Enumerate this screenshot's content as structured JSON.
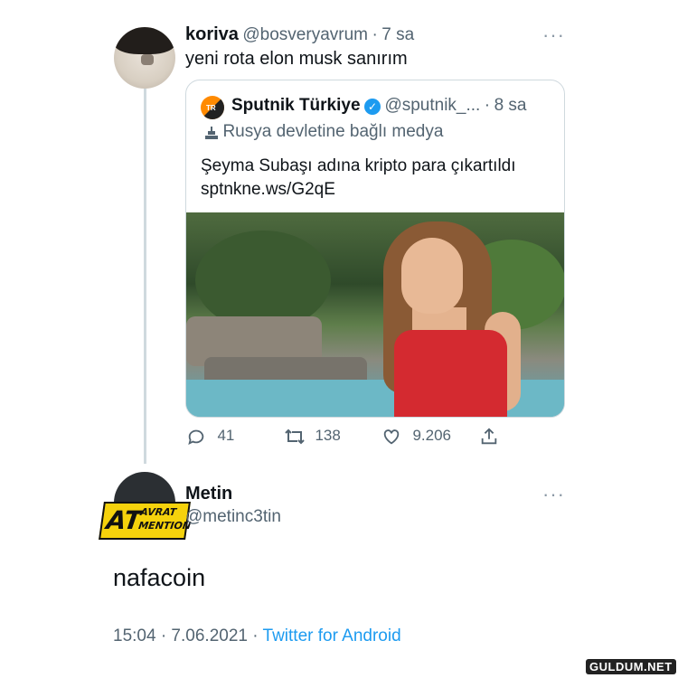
{
  "reply": {
    "display_name": "koriva",
    "handle": "@bosveryavrum",
    "separator": "·",
    "time": "7 sa",
    "text": "yeni rota elon musk sanırım",
    "more_icon": "···"
  },
  "quoted": {
    "source_name": "Sputnik Türkiye",
    "verified_icon": "✓",
    "handle": "@sputnik_...",
    "separator": "·",
    "time": "8 sa",
    "label_icon": "state-media-icon",
    "label": "Rusya devletine bağlı medya",
    "text_line1": "Şeyma Subaşı adına kripto para çıkartıldı",
    "text_line2": "sptnkne.ws/G2qE",
    "logo_text": "TR"
  },
  "actions": {
    "replies": "41",
    "retweets": "138",
    "likes": "9.206"
  },
  "main": {
    "display_name": "Metin",
    "handle": "@metinc3tin",
    "more_icon": "···",
    "badge_big": "AT",
    "badge_top": "AVRAT",
    "badge_bottom": "MENTION",
    "text": "nafacoin",
    "timestamp": "15:04 · 7.06.2021 ·",
    "client": "Twitter for Android"
  },
  "watermark": "GULDUM.NET",
  "colors": {
    "link": "#1d9bf0",
    "muted": "#536471",
    "badge": "#f5d20c"
  }
}
